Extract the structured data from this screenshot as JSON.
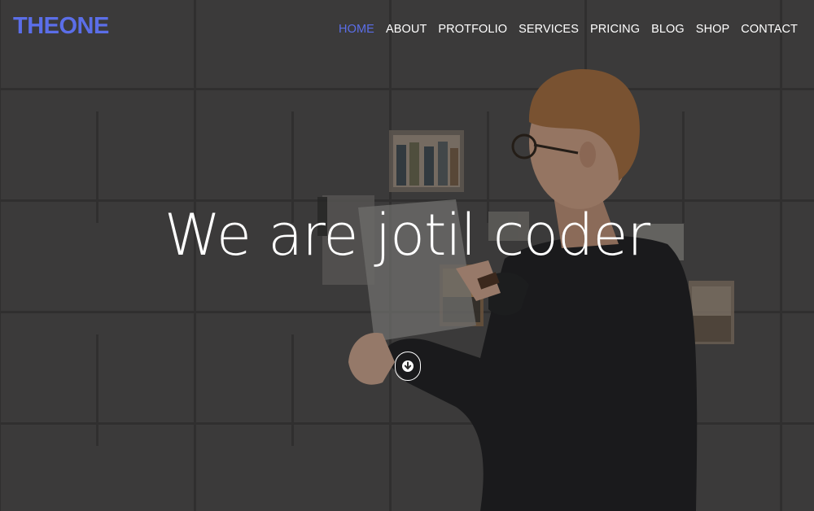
{
  "brand": {
    "logo_text": "THEONE",
    "accent_color": "#5b6ee8"
  },
  "nav": {
    "items": [
      {
        "label": "HOME",
        "active": true
      },
      {
        "label": "ABOUT",
        "active": false
      },
      {
        "label": "PROTFOLIO",
        "active": false
      },
      {
        "label": "SERVICES",
        "active": false
      },
      {
        "label": "PRICING",
        "active": false
      },
      {
        "label": "BLOG",
        "active": false
      },
      {
        "label": "SHOP",
        "active": false
      },
      {
        "label": "CONTACT",
        "active": false
      }
    ]
  },
  "hero": {
    "headline": "We are jotil coder",
    "scroll_icon": "arrow-down-circle-icon"
  }
}
